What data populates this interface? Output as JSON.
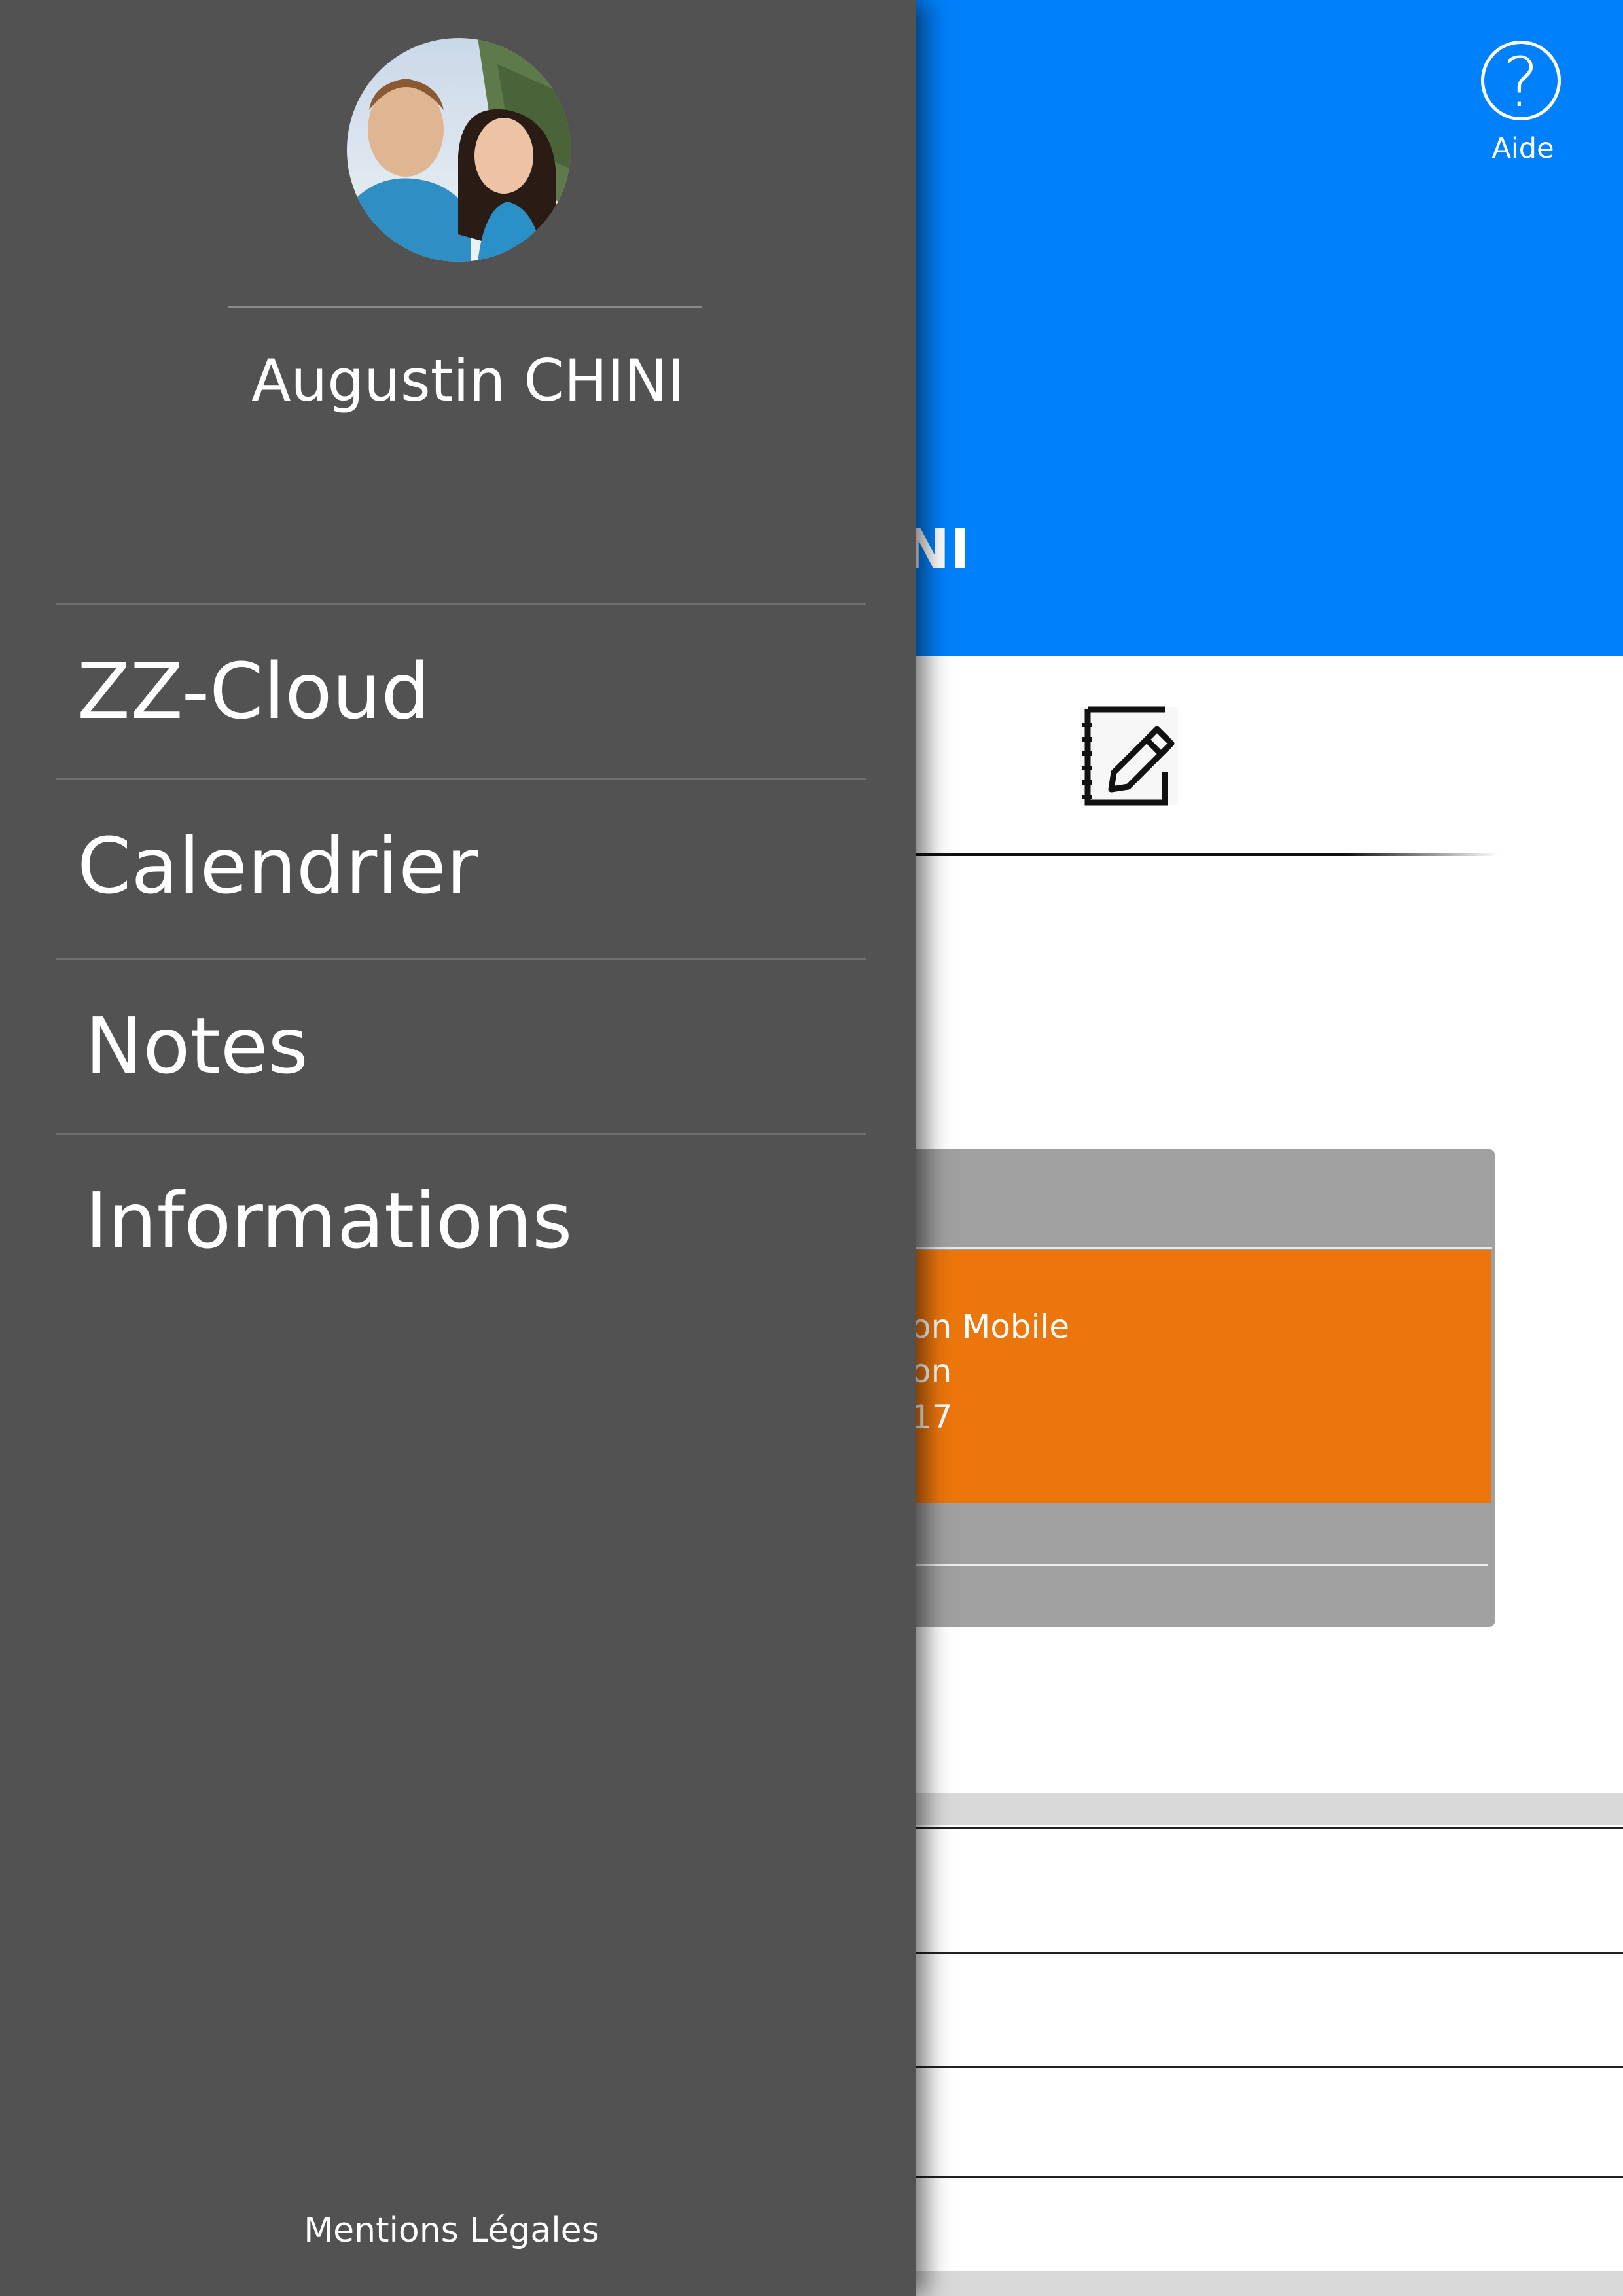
{
  "header": {
    "help_label": "Aide",
    "help_icon": "question-circle-icon",
    "name_partial": "in CHINI",
    "color": "#0080fa"
  },
  "toolbar": {
    "edit_icon": "notebook-edit-icon"
  },
  "event_card": {
    "line1": "on Mobile",
    "line2": "on",
    "line3": "17",
    "color": "#ec760c"
  },
  "drawer": {
    "background": "#525252",
    "avatar_icon": "profile-photo",
    "user_name": "Augustin CHINI",
    "menu": [
      {
        "label": "ZZ-Cloud"
      },
      {
        "label": "Calendrier"
      },
      {
        "label": "Notes"
      },
      {
        "label": "Informations"
      }
    ],
    "legal_link": "Mentions Légales"
  }
}
